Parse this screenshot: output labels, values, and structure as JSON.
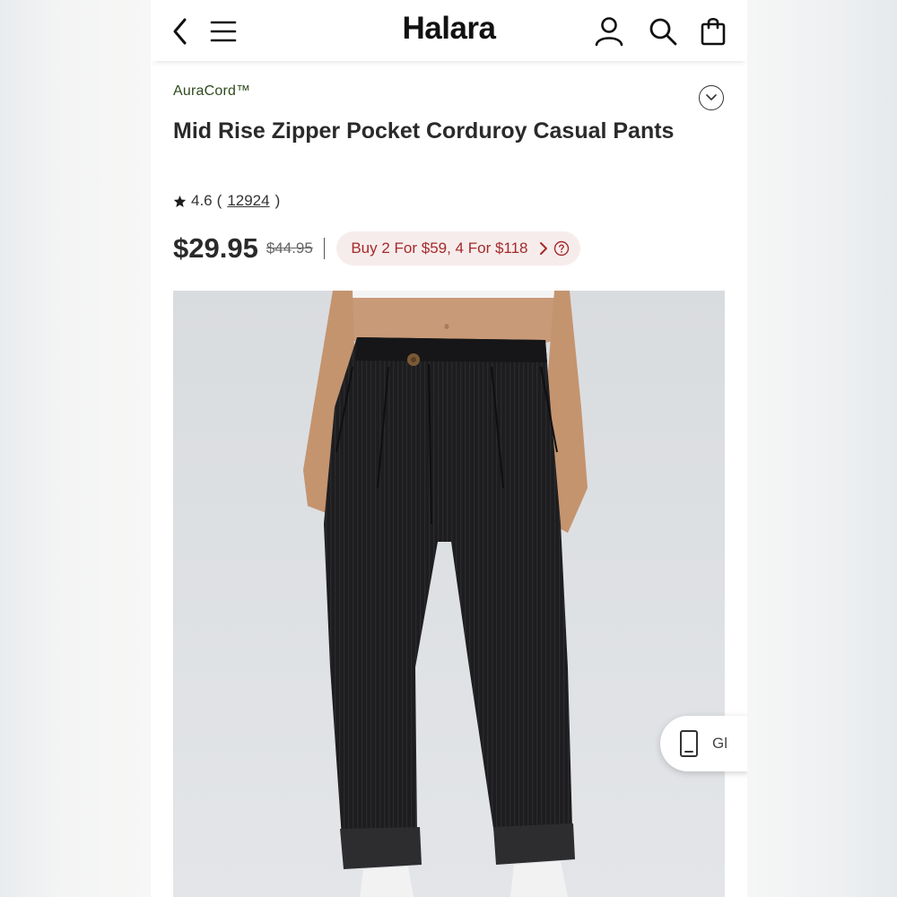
{
  "header": {
    "logo": "Halara",
    "icons": [
      "chevron-left-icon",
      "menu-icon",
      "user-icon",
      "search-icon",
      "shopping-bag-icon"
    ]
  },
  "product": {
    "brand": "AuraCord™",
    "title": "Mid Rise Zipper Pocket Corduroy Casual Pants",
    "rating": "4.6",
    "rating_open": "(",
    "review_count": "12924",
    "rating_close": ")",
    "price": "$29.95",
    "original_price": "$44.95",
    "promo": "Buy 2 For $59, 4 For $118"
  },
  "floating_button": {
    "label": "Gl"
  },
  "colors": {
    "brand_green": "#2f4a1e",
    "promo_text": "#a52a2a",
    "promo_bg": "#f7ecec"
  }
}
